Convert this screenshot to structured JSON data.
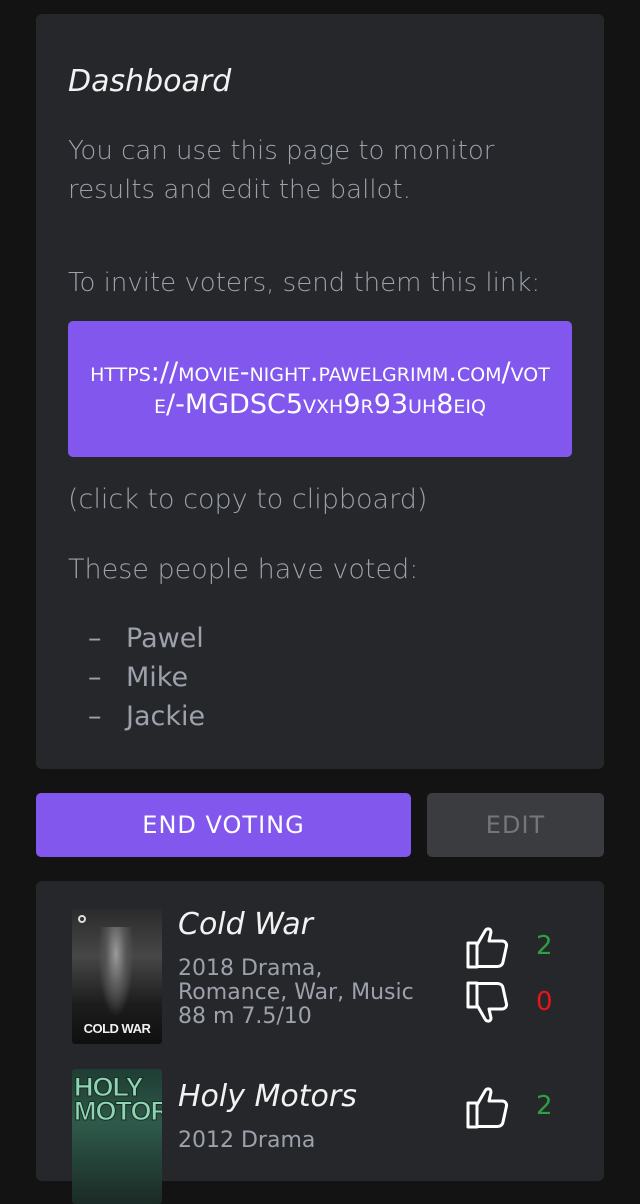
{
  "dashboard": {
    "title": "Dashboard",
    "description": "You can use this page to monitor results and edit the ballot.",
    "invite_label": "To invite voters, send them this link:",
    "invite_link": "https://movie-night.pawelgrimm.com/vote/-MGDSC5vxh9r93uh8eiq",
    "copy_hint": "(click to copy to clipboard)",
    "voted_label": "These people have voted:",
    "voters": [
      "Pawel",
      "Mike",
      "Jackie"
    ],
    "list_marker": "–"
  },
  "actions": {
    "end_voting_label": "END VOTING",
    "edit_label": "EDIT"
  },
  "movies": [
    {
      "title": "Cold War",
      "meta": "2018  Drama, Romance, War, Music  88 m  7.5/10",
      "poster_text": "COLD WAR",
      "upvotes": "2",
      "downvotes": "0"
    },
    {
      "title": "Holy Motors",
      "meta": "2012  Drama",
      "poster_text": "HOLY MOTORS",
      "upvotes": "2"
    }
  ],
  "colors": {
    "accent": "#8257ee",
    "card": "#25272b",
    "upvote": "#2ea043",
    "downvote": "#e5141e"
  },
  "icons": {
    "upvote": "thumbs-up-icon",
    "downvote": "thumbs-down-icon"
  }
}
